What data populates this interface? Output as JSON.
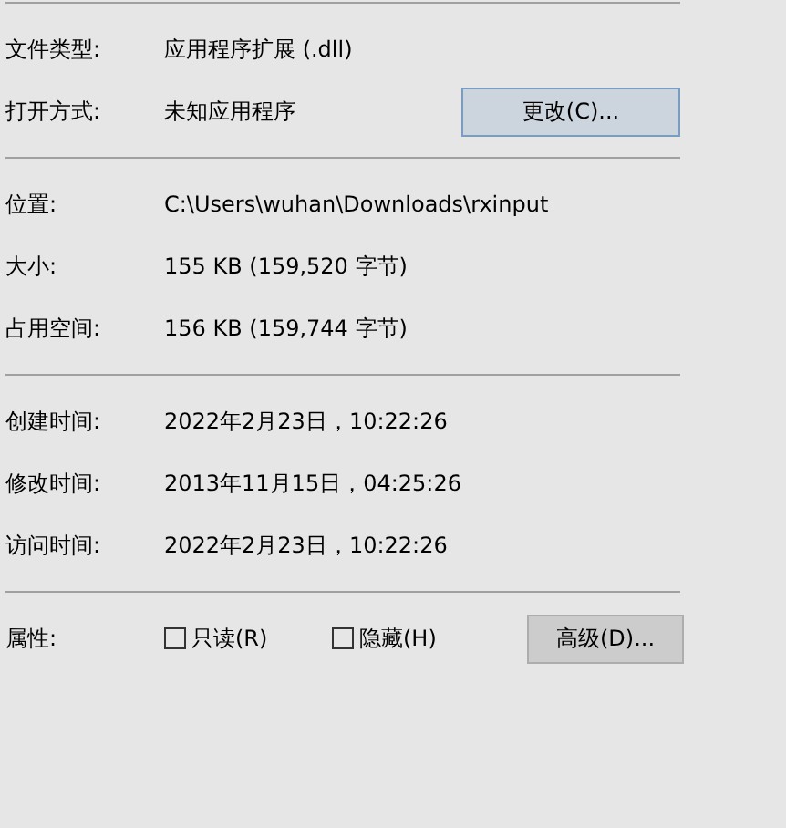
{
  "sections": [
    {
      "rows": [
        {
          "label": "文件类型:",
          "value": "应用程序扩展 (.dll)"
        },
        {
          "label": "打开方式:",
          "value": "未知应用程序",
          "button": {
            "label": "更改(C)...",
            "focused": true
          }
        }
      ]
    },
    {
      "rows": [
        {
          "label": "位置:",
          "value": "C:\\Users\\wuhan\\Downloads\\rxinput"
        },
        {
          "label": "大小:",
          "value": "155 KB (159,520 字节)"
        },
        {
          "label": "占用空间:",
          "value": "156 KB (159,744 字节)"
        }
      ]
    },
    {
      "rows": [
        {
          "label": "创建时间:",
          "value": "2022年2月23日，10:22:26"
        },
        {
          "label": "修改时间:",
          "value": "2013年11月15日，04:25:26"
        },
        {
          "label": "访问时间:",
          "value": "2022年2月23日，10:22:26"
        }
      ]
    }
  ],
  "attributes": {
    "label": "属性:",
    "checkboxes": [
      {
        "label": "只读(R)",
        "checked": false
      },
      {
        "label": "隐藏(H)",
        "checked": false
      }
    ],
    "button": {
      "label": "高级(D)...",
      "focused": false
    }
  }
}
